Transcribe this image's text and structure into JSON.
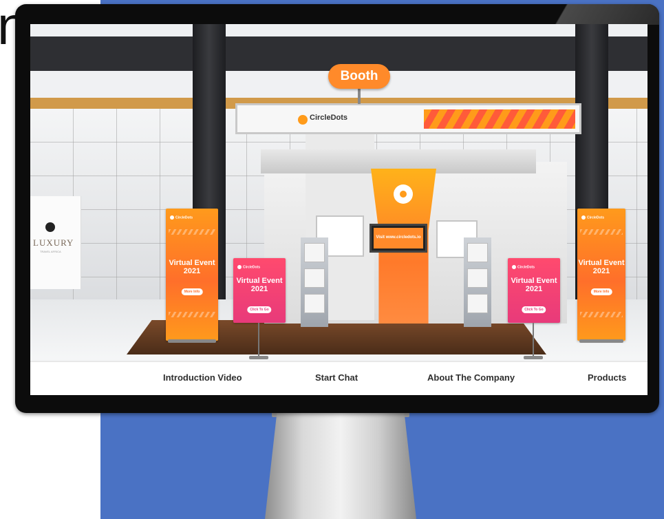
{
  "hero": {
    "partial_heading": "n"
  },
  "booth": {
    "label": "Booth",
    "company": "CircleDots",
    "screen_text": "Visit www.circledots.io"
  },
  "luxury_sign": {
    "name": "LUXURY",
    "subtitle": "TRAVEL AFRICA"
  },
  "banners": [
    {
      "logo": "CircleDots",
      "event": "Virtual Event 2021",
      "button": "More Info"
    },
    {
      "logo": "CircleDots",
      "event": "Virtual Event 2021",
      "button": "Click To Go"
    },
    {
      "logo": "CircleDots",
      "event": "Virtual Event 2021",
      "button": "Click To Go"
    },
    {
      "logo": "CircleDots",
      "event": "Virtual Event 2021",
      "button": "More Info"
    }
  ],
  "nav": {
    "items": [
      {
        "label": "Introduction Video"
      },
      {
        "label": "Start Chat"
      },
      {
        "label": "About The Company"
      },
      {
        "label": "Products"
      }
    ]
  },
  "colors": {
    "background_blue": "#4a72c4",
    "accent_orange": "#ff8a2a",
    "accent_pink": "#ff4a6e"
  },
  "icons": [
    "circledots-logo-icon",
    "booth-logo-icon"
  ]
}
